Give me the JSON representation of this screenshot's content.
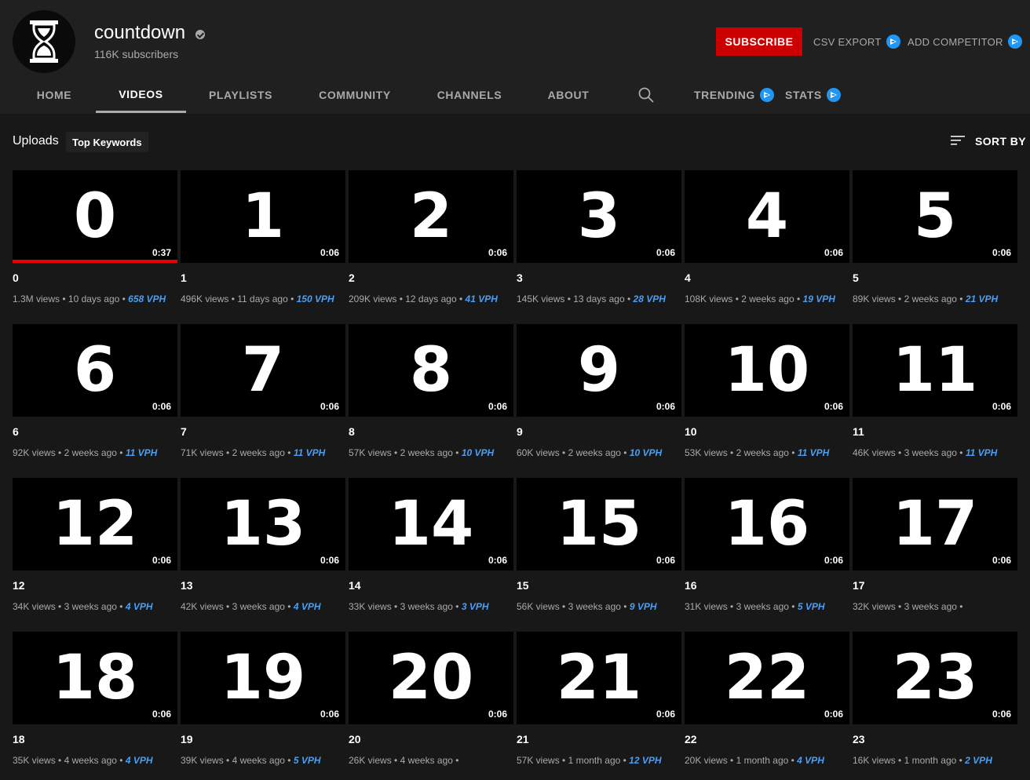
{
  "channel": {
    "name": "countdown",
    "subscribers": "116K subscribers"
  },
  "actions": {
    "subscribe": "SUBSCRIBE",
    "csv_export": "CSV EXPORT",
    "add_competitor": "ADD COMPETITOR"
  },
  "tabs": [
    {
      "label": "HOME",
      "active": false
    },
    {
      "label": "VIDEOS",
      "active": true
    },
    {
      "label": "PLAYLISTS",
      "active": false
    },
    {
      "label": "COMMUNITY",
      "active": false
    },
    {
      "label": "CHANNELS",
      "active": false
    },
    {
      "label": "ABOUT",
      "active": false
    }
  ],
  "ext_tabs": {
    "trending": "TRENDING",
    "stats": "STATS"
  },
  "uploads": {
    "label": "Uploads",
    "chip": "Top Keywords",
    "sort_label": "SORT BY"
  },
  "colors": {
    "subscribe": "#cc0000",
    "ext_accent": "#2196f3",
    "vph": "#4a9ff5"
  },
  "videos": [
    {
      "title": "0",
      "thumb": "0",
      "duration": "0:37",
      "views": "1.3M views",
      "age": "10 days ago",
      "vph": "658 VPH",
      "watched": true
    },
    {
      "title": "1",
      "thumb": "1",
      "duration": "0:06",
      "views": "496K views",
      "age": "11 days ago",
      "vph": "150 VPH"
    },
    {
      "title": "2",
      "thumb": "2",
      "duration": "0:06",
      "views": "209K views",
      "age": "12 days ago",
      "vph": "41 VPH"
    },
    {
      "title": "3",
      "thumb": "3",
      "duration": "0:06",
      "views": "145K views",
      "age": "13 days ago",
      "vph": "28 VPH"
    },
    {
      "title": "4",
      "thumb": "4",
      "duration": "0:06",
      "views": "108K views",
      "age": "2 weeks ago",
      "vph": "19 VPH"
    },
    {
      "title": "5",
      "thumb": "5",
      "duration": "0:06",
      "views": "89K views",
      "age": "2 weeks ago",
      "vph": "21 VPH"
    },
    {
      "title": "6",
      "thumb": "6",
      "duration": "0:06",
      "views": "92K views",
      "age": "2 weeks ago",
      "vph": "11 VPH"
    },
    {
      "title": "7",
      "thumb": "7",
      "duration": "0:06",
      "views": "71K views",
      "age": "2 weeks ago",
      "vph": "11 VPH"
    },
    {
      "title": "8",
      "thumb": "8",
      "duration": "0:06",
      "views": "57K views",
      "age": "2 weeks ago",
      "vph": "10 VPH"
    },
    {
      "title": "9",
      "thumb": "9",
      "duration": "0:06",
      "views": "60K views",
      "age": "2 weeks ago",
      "vph": "10 VPH"
    },
    {
      "title": "10",
      "thumb": "10",
      "duration": "0:06",
      "views": "53K views",
      "age": "2 weeks ago",
      "vph": "11 VPH"
    },
    {
      "title": "11",
      "thumb": "11",
      "duration": "0:06",
      "views": "46K views",
      "age": "3 weeks ago",
      "vph": "11 VPH"
    },
    {
      "title": "12",
      "thumb": "12",
      "duration": "0:06",
      "views": "34K views",
      "age": "3 weeks ago",
      "vph": "4 VPH"
    },
    {
      "title": "13",
      "thumb": "13",
      "duration": "0:06",
      "views": "42K views",
      "age": "3 weeks ago",
      "vph": "4 VPH"
    },
    {
      "title": "14",
      "thumb": "14",
      "duration": "0:06",
      "views": "33K views",
      "age": "3 weeks ago",
      "vph": "3 VPH"
    },
    {
      "title": "15",
      "thumb": "15",
      "duration": "0:06",
      "views": "56K views",
      "age": "3 weeks ago",
      "vph": "9 VPH"
    },
    {
      "title": "16",
      "thumb": "16",
      "duration": "0:06",
      "views": "31K views",
      "age": "3 weeks ago",
      "vph": "5 VPH"
    },
    {
      "title": "17",
      "thumb": "17",
      "duration": "0:06",
      "views": "32K views",
      "age": "3 weeks ago",
      "vph": ""
    },
    {
      "title": "18",
      "thumb": "18",
      "duration": "0:06",
      "views": "35K views",
      "age": "4 weeks ago",
      "vph": "4 VPH"
    },
    {
      "title": "19",
      "thumb": "19",
      "duration": "0:06",
      "views": "39K views",
      "age": "4 weeks ago",
      "vph": "5 VPH"
    },
    {
      "title": "20",
      "thumb": "20",
      "duration": "0:06",
      "views": "26K views",
      "age": "4 weeks ago",
      "vph": ""
    },
    {
      "title": "21",
      "thumb": "21",
      "duration": "0:06",
      "views": "57K views",
      "age": "1 month ago",
      "vph": "12 VPH"
    },
    {
      "title": "22",
      "thumb": "22",
      "duration": "0:06",
      "views": "20K views",
      "age": "1 month ago",
      "vph": "4 VPH"
    },
    {
      "title": "23",
      "thumb": "23",
      "duration": "0:06",
      "views": "16K views",
      "age": "1 month ago",
      "vph": "2 VPH"
    }
  ]
}
